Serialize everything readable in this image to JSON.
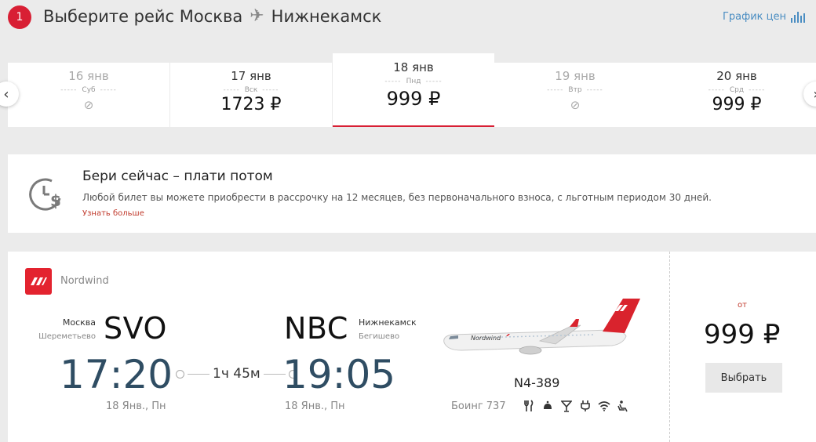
{
  "header": {
    "step": "1",
    "title_prefix": "Выберите рейс Москва",
    "title_destination": "Нижнекамск",
    "price_chart_label": "График цен"
  },
  "date_strip": {
    "prev_icon": "chevron-left-icon",
    "next_icon": "chevron-right-icon",
    "days": [
      {
        "date": "16 янв",
        "weekday": "Суб",
        "price": "",
        "available": false
      },
      {
        "date": "17 янв",
        "weekday": "Вск",
        "price": "1723 ₽",
        "available": true
      },
      {
        "date": "18 янв",
        "weekday": "Пнд",
        "price": "999 ₽",
        "available": true,
        "selected": true
      },
      {
        "date": "19 янв",
        "weekday": "Втр",
        "price": "",
        "available": false
      },
      {
        "date": "20 янв",
        "weekday": "Срд",
        "price": "999 ₽",
        "available": true
      }
    ],
    "unavailable_icon": "⊘"
  },
  "promo": {
    "title": "Бери сейчас – плати потом",
    "text": "Любой билет вы можете приобрести в рассрочку на 12 месяцев, без первоначального взноса, с льготным периодом 30 дней.",
    "link": "Узнать больше"
  },
  "flight": {
    "airline": "Nordwind",
    "departure": {
      "city": "Москва",
      "airport": "Шереметьево",
      "code": "SVO",
      "time": "17:20",
      "date": "18 Янв., Пн"
    },
    "arrival": {
      "city": "Нижнекамск",
      "airport": "Бегишево",
      "code": "NBC",
      "time": "19:05",
      "date": "18 Янв., Пн"
    },
    "duration": "1ч 45м",
    "flight_number": "N4-389",
    "aircraft": "Боинг 737",
    "amenities": [
      "meal-icon",
      "snack-icon",
      "drinks-icon",
      "power-outlet-icon",
      "wifi-icon",
      "seat-icon"
    ],
    "price_from_label": "от",
    "price": "999 ₽",
    "select_label": "Выбрать"
  },
  "colors": {
    "accent": "#d81f34",
    "time_text": "#2f4d63",
    "link_blue": "#4a8dc2",
    "background": "#ebebeb"
  }
}
